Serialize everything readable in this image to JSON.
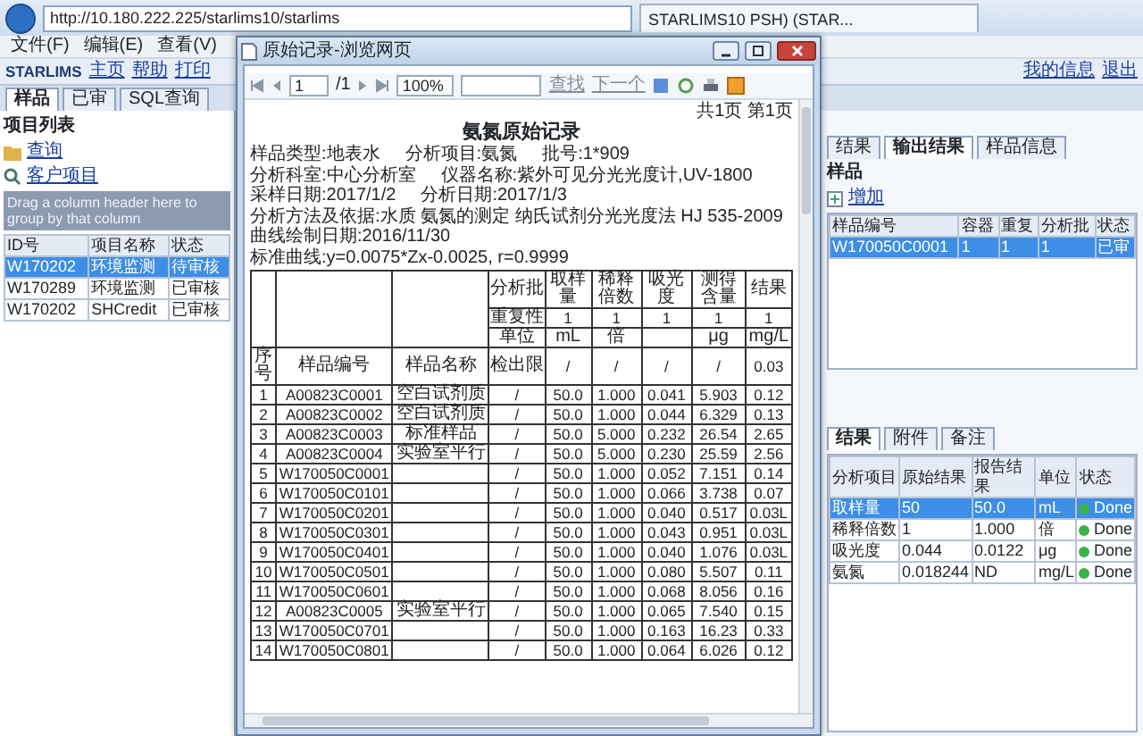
{
  "browser": {
    "address": "http://10.180.222.225/starlims10/starlims",
    "tab_title": "STARLIMS10 PSH) (STAR..."
  },
  "menu": [
    "文件(F)",
    "编辑(E)",
    "查看(V)"
  ],
  "app_toolbar": {
    "brand": "STARLIMS",
    "left": [
      "主页",
      "帮助",
      "打印"
    ],
    "right": [
      "我的信息",
      "退出"
    ]
  },
  "left_panel": {
    "tabs": [
      {
        "label": "样品",
        "selected": true
      },
      {
        "label": "已审",
        "selected": false
      },
      {
        "label": "SQL查询",
        "selected": false
      }
    ],
    "title": "项目列表",
    "links": [
      {
        "label": "查询",
        "kind": "folder"
      },
      {
        "label": "客户项目",
        "kind": "search"
      }
    ],
    "group_hint": "Drag a column header here to group by that column",
    "columns": [
      "ID号",
      "项目名称",
      "状态"
    ],
    "rows": [
      {
        "cells": [
          "W170202",
          "环境监测",
          "待审核"
        ],
        "selected": true
      },
      {
        "cells": [
          "W170289",
          "环境监测",
          "已审核"
        ],
        "selected": false
      },
      {
        "cells": [
          "W170202",
          "SHCredit",
          "已审核"
        ],
        "selected": false
      }
    ]
  },
  "dialog": {
    "title": "原始记录-浏览网页",
    "toolbar": {
      "page": "1",
      "page_total": "/1",
      "zoom": "100%",
      "find": "查找",
      "next": "下一个"
    },
    "report": {
      "page_info": "共1页 第1页",
      "title": "氨氮原始记录",
      "lines": [
        [
          "样品类型:地表水",
          "分析项目:氨氮",
          "批号:1*909"
        ],
        [
          "分析科室:中心分析室",
          "仪器名称:紫外可见分光光度计,UV-1800"
        ],
        [
          "采样日期:2017/1/2",
          "分析日期:2017/1/3"
        ],
        [
          "分析方法及依据:水质 氨氮的测定 纳氏试剂分光光度法 HJ 535-2009"
        ],
        [
          "曲线绘制日期:2016/11/30"
        ],
        [
          "标准曲线:y=0.0075*Zx-0.0025, r=0.9999"
        ]
      ],
      "head": [
        "分析批",
        "取样量",
        "稀释倍数",
        "吸光度",
        "测得含量",
        "结果"
      ],
      "repeat": {
        "label": "重复性",
        "values": [
          "1",
          "1",
          "1",
          "1",
          "1"
        ]
      },
      "units": {
        "label": "单位",
        "vol": "mL",
        "dil": "倍",
        "content": "μg",
        "result": "mg/L"
      },
      "columns": {
        "labels": [
          "序号",
          "样品编号",
          "样品名称",
          "检出限"
        ],
        "values": [
          "/",
          "/",
          "/",
          "/",
          "0.03"
        ]
      },
      "rows": [
        {
          "no": "1",
          "id": "A00823C0001",
          "name": "空白试剂质",
          "limit": "/",
          "vol": "50.0",
          "dil": "1.000",
          "abs": "0.041",
          "content": "5.903",
          "result": "0.12"
        },
        {
          "no": "2",
          "id": "A00823C0002",
          "name": "空白试剂质",
          "limit": "/",
          "vol": "50.0",
          "dil": "1.000",
          "abs": "0.044",
          "content": "6.329",
          "result": "0.13"
        },
        {
          "no": "3",
          "id": "A00823C0003",
          "name": "标准样品",
          "limit": "/",
          "vol": "50.0",
          "dil": "5.000",
          "abs": "0.232",
          "content": "26.54",
          "result": "2.65"
        },
        {
          "no": "4",
          "id": "A00823C0004",
          "name": "实验室平行",
          "limit": "/",
          "vol": "50.0",
          "dil": "5.000",
          "abs": "0.230",
          "content": "25.59",
          "result": "2.56"
        },
        {
          "no": "5",
          "id": "W170050C0001",
          "limit": "/",
          "vol": "50.0",
          "dil": "1.000",
          "abs": "0.052",
          "content": "7.151",
          "result": "0.14"
        },
        {
          "no": "6",
          "id": "W170050C0101",
          "limit": "/",
          "vol": "50.0",
          "dil": "1.000",
          "abs": "0.066",
          "content": "3.738",
          "result": "0.07"
        },
        {
          "no": "7",
          "id": "W170050C0201",
          "limit": "/",
          "vol": "50.0",
          "dil": "1.000",
          "abs": "0.040",
          "content": "0.517",
          "result": "0.03L"
        },
        {
          "no": "8",
          "id": "W170050C0301",
          "limit": "/",
          "vol": "50.0",
          "dil": "1.000",
          "abs": "0.043",
          "content": "0.951",
          "result": "0.03L"
        },
        {
          "no": "9",
          "id": "W170050C0401",
          "limit": "/",
          "vol": "50.0",
          "dil": "1.000",
          "abs": "0.040",
          "content": "1.076",
          "result": "0.03L"
        },
        {
          "no": "10",
          "id": "W170050C0501",
          "limit": "/",
          "vol": "50.0",
          "dil": "1.000",
          "abs": "0.080",
          "content": "5.507",
          "result": "0.11"
        },
        {
          "no": "11",
          "id": "W170050C0601",
          "limit": "/",
          "vol": "50.0",
          "dil": "1.000",
          "abs": "0.068",
          "content": "8.056",
          "result": "0.16"
        },
        {
          "no": "12",
          "id": "A00823C0005",
          "name": "实验室平行",
          "limit": "/",
          "vol": "50.0",
          "dil": "1.000",
          "abs": "0.065",
          "content": "7.540",
          "result": "0.15"
        },
        {
          "no": "13",
          "id": "W170050C0701",
          "limit": "/",
          "vol": "50.0",
          "dil": "1.000",
          "abs": "0.163",
          "content": "16.23",
          "result": "0.33"
        },
        {
          "no": "14",
          "id": "W170050C0801",
          "limit": "/",
          "vol": "50.0",
          "dil": "1.000",
          "abs": "0.064",
          "content": "6.026",
          "result": "0.12"
        }
      ]
    }
  },
  "right_panel": {
    "tabs": [
      {
        "label": "结果",
        "selected": false
      },
      {
        "label": "输出结果",
        "selected": true
      },
      {
        "label": "样品信息",
        "selected": false
      }
    ],
    "section": "样品",
    "add": "增加",
    "columns": [
      "样品编号",
      "容器",
      "重复",
      "分析批",
      "状态"
    ],
    "rows": [
      {
        "cells": [
          "W170050C0001",
          "1",
          "1",
          "1",
          "已审"
        ],
        "selected": true
      }
    ],
    "lower_tabs": [
      {
        "label": "结果",
        "selected": true
      },
      {
        "label": "附件",
        "selected": false
      },
      {
        "label": "备注",
        "selected": false
      }
    ],
    "result_columns": [
      "分析项目",
      "原始结果",
      "报告结果",
      "单位",
      "状态"
    ],
    "results": [
      {
        "cells": [
          "取样量",
          "50",
          "50.0",
          "mL",
          "Done"
        ],
        "selected": true
      },
      {
        "cells": [
          "稀释倍数",
          "1",
          "1.000",
          "倍",
          "Done"
        ],
        "selected": false
      },
      {
        "cells": [
          "吸光度",
          "0.044",
          "0.0122",
          "μg",
          "Done"
        ],
        "selected": false
      },
      {
        "cells": [
          "氨氮",
          "0.018244",
          "ND",
          "mg/L",
          "Done"
        ],
        "selected": false
      }
    ]
  }
}
